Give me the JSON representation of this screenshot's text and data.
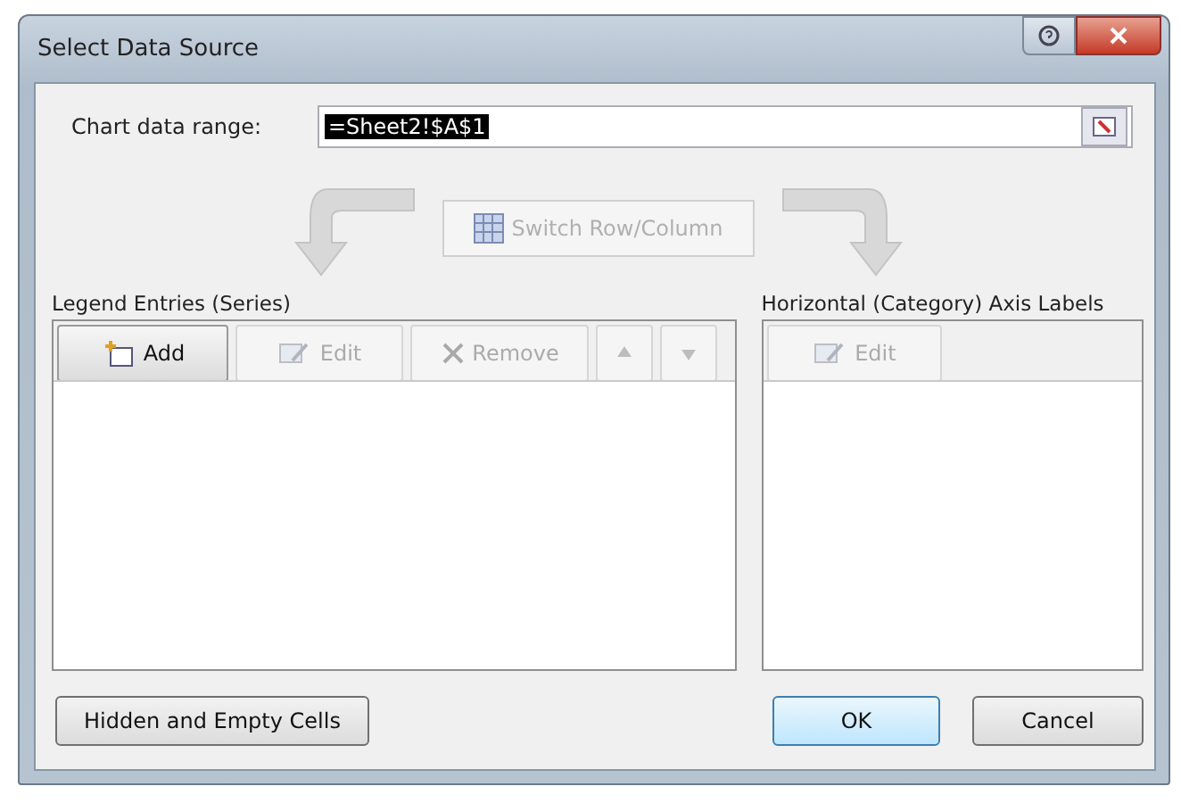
{
  "window": {
    "title": "Select Data Source"
  },
  "range": {
    "label": "Chart data range:",
    "value": "=Sheet2!$A$1",
    "value_selected": true
  },
  "switch_button": {
    "label": "Switch Row/Column",
    "disabled": true
  },
  "legend": {
    "title": "Legend Entries (Series)",
    "toolbar": [
      {
        "kind": "add",
        "label": "Add",
        "disabled": false
      },
      {
        "kind": "edit",
        "label": "Edit",
        "disabled": true
      },
      {
        "kind": "remove",
        "label": "Remove",
        "disabled": true
      },
      {
        "kind": "up",
        "disabled": true
      },
      {
        "kind": "down",
        "disabled": true
      }
    ]
  },
  "axis": {
    "title": "Horizontal (Category) Axis Labels",
    "toolbar": [
      {
        "kind": "edit",
        "label": "Edit",
        "disabled": true
      }
    ]
  },
  "footer": {
    "hidden_cells_button": "Hidden and Empty Cells",
    "ok_button": "OK",
    "cancel_button": "Cancel"
  }
}
